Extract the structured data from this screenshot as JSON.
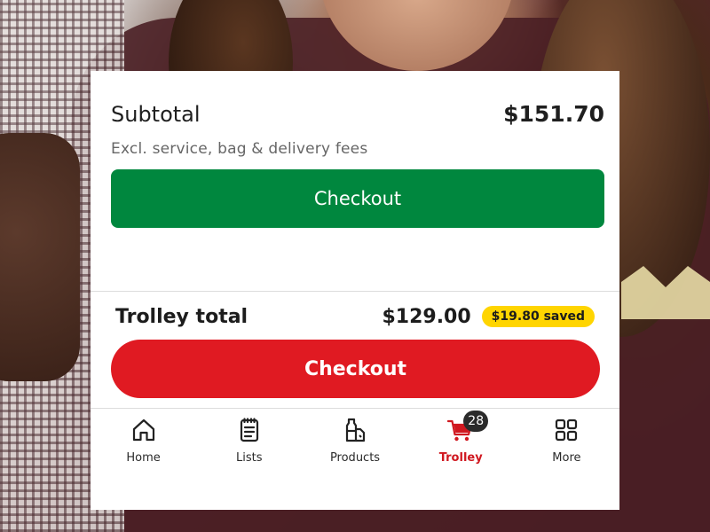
{
  "summary": {
    "subtotal_label": "Subtotal",
    "subtotal_amount": "$151.70",
    "fees_note": "Excl. service, bag & delivery fees",
    "checkout_label": "Checkout"
  },
  "trolley": {
    "total_label": "Trolley total",
    "total_amount": "$129.00",
    "saved_badge": "$19.80 saved",
    "checkout_label": "Checkout"
  },
  "nav": {
    "items": [
      {
        "label": "Home",
        "icon": "home-icon"
      },
      {
        "label": "Lists",
        "icon": "list-icon"
      },
      {
        "label": "Products",
        "icon": "products-icon"
      },
      {
        "label": "Trolley",
        "icon": "cart-icon",
        "active": true,
        "badge": "28"
      },
      {
        "label": "More",
        "icon": "grid-icon"
      }
    ]
  },
  "colors": {
    "checkout_green": "#00873e",
    "checkout_red": "#e01a22",
    "saved_badge": "#ffd500",
    "nav_active": "#d01820"
  }
}
